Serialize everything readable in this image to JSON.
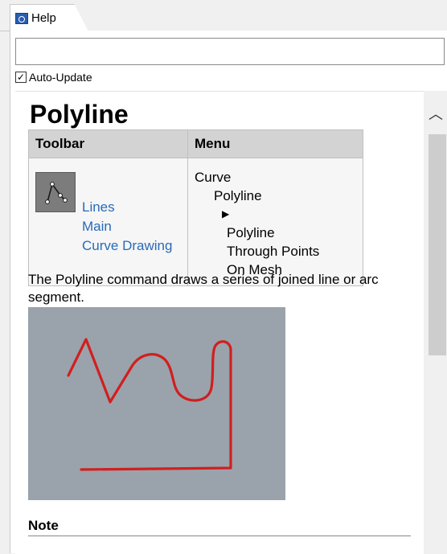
{
  "tab": {
    "label": "Help",
    "icon": "help-window-icon"
  },
  "search": {
    "value": "",
    "placeholder": ""
  },
  "auto_update": {
    "label": "Auto-Update",
    "checked": true
  },
  "article": {
    "title": "Polyline",
    "table_headers": {
      "toolbar": "Toolbar",
      "menu": "Menu"
    },
    "toolbar_icon": "polyline-icon",
    "toolbar_links": [
      "Lines",
      "Main",
      "Curve Drawing"
    ],
    "menu_path": {
      "level1": "Curve",
      "level2": "Polyline",
      "level3": [
        "Polyline",
        "Through Points",
        "On Mesh"
      ]
    },
    "description": "The Polyline command draws a series of joined line or arc segment.",
    "note_heading": "Note"
  },
  "colors": {
    "link": "#2a6ab8",
    "illustration_bg": "#9aa3ab",
    "polyline_stroke": "#d11f1f"
  }
}
